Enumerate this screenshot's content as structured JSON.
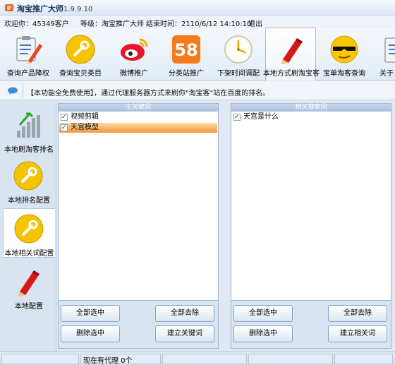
{
  "window": {
    "title": "淘宝推广大师",
    "version": "1.9.9.10"
  },
  "infobar": {
    "welcome": "欢迎你：45349客户",
    "level": "等级：淘宝推广大师",
    "end_time": "结束时间：2110/6/12 14:10:10",
    "logout": "退出"
  },
  "toolbar": {
    "items": [
      {
        "label": "查询产品降权",
        "icon": "clipboard-pencil-icon"
      },
      {
        "label": "查询宝贝类目",
        "icon": "wrench-icon"
      },
      {
        "label": "微博推广",
        "icon": "weibo-icon"
      },
      {
        "label": "分类站推广",
        "icon": "58-icon",
        "badge": "58"
      },
      {
        "label": "下架时间调配",
        "icon": "clock-icon"
      },
      {
        "label": "本地方式刷淘宝客",
        "icon": "pen-icon"
      },
      {
        "label": "宝单淘客查询",
        "icon": "cool-face-icon"
      },
      {
        "label": "关于",
        "icon": "about-icon"
      }
    ],
    "active_index": 5
  },
  "notice": {
    "text": "【本功能全免费使用】，通过代理服务器方式来刷你\"淘宝客\"站在百度的排名。"
  },
  "leftnav": {
    "items": [
      {
        "label": "本地刷淘客排名",
        "icon": "bar-chart-icon"
      },
      {
        "label": "本地排名配置",
        "icon": "wrench-icon"
      },
      {
        "label": "本地相关词配置",
        "icon": "wrench-icon"
      },
      {
        "label": "本地配置",
        "icon": "pen-icon"
      }
    ],
    "active_index": 2
  },
  "main_keywords": {
    "header": "主关键词",
    "items": [
      {
        "text": "视频剪辑",
        "checked": true,
        "selected": false
      },
      {
        "text": "天宫模型",
        "checked": true,
        "selected": true
      }
    ],
    "buttons": {
      "select_all": "全部选中",
      "remove_all": "全部去除",
      "delete_selected": "删除选中",
      "create": "建立关键词"
    }
  },
  "related_keywords": {
    "header": "相关搜索词",
    "items": [
      {
        "text": "天宫是什么",
        "checked": true,
        "selected": false
      }
    ],
    "buttons": {
      "select_all": "全部选中",
      "remove_all": "全部去除",
      "delete_selected": "删除选中",
      "create": "建立相关词"
    }
  },
  "statusbar": {
    "proxy_text": "现在有代理 0个"
  }
}
